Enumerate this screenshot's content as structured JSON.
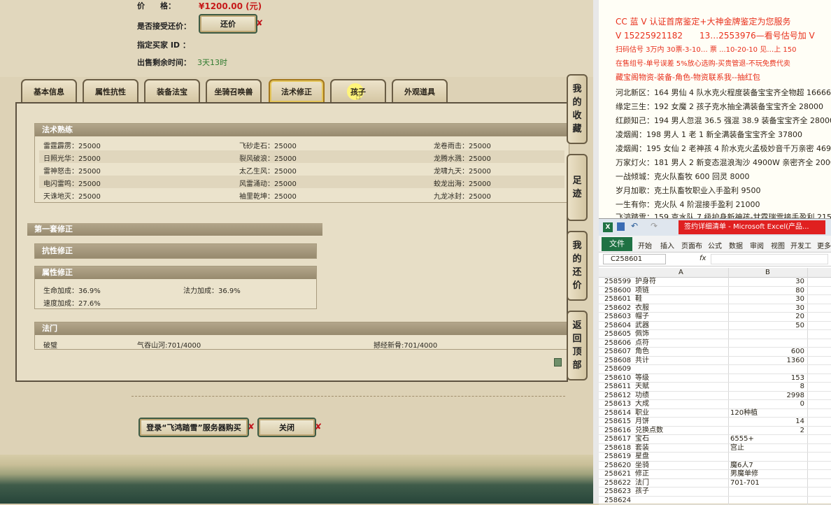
{
  "game": {
    "price_label": "价　　格：",
    "price_value": "¥1200.00 (元)",
    "accept_label": "是否接受还价：",
    "counter_btn": "还价",
    "buyer_label": "指定买家 ID ：",
    "time_label": "出售剩余时间：",
    "time_value": "3天13时",
    "tabs": [
      "基本信息",
      "属性抗性",
      "装备法宝",
      "坐骑召唤兽",
      "法术修正",
      "孩子",
      "外观道具"
    ],
    "skill_header": "法术熟练",
    "skills": [
      [
        "雷霆霹雳：25000",
        "飞砂走石：25000",
        "龙卷雨击：25000"
      ],
      [
        "日照光华：25000",
        "裂风破浪：25000",
        "龙腾水溅：25000"
      ],
      [
        "雷神怒击：25000",
        "太乙生风：25000",
        "龙啸九天：25000"
      ],
      [
        "电闪雷鸣：25000",
        "风雷涌动：25000",
        "蛟龙出海：25000"
      ],
      [
        "天诛地灭：25000",
        "袖里乾坤：25000",
        "九龙冰封：25000"
      ]
    ],
    "mod_set_header": "第一套修正",
    "resist_header": "抗性修正",
    "attr_header": "属性修正",
    "attr_hp": "生命加成：36.9%",
    "attr_mp": "法力加成：36.9%",
    "attr_speed": "速度加成：27.6%",
    "fa_header": "法门",
    "fa_items": [
      "破璧",
      "气吞山河:701/4000",
      "撼经新骨:701/4000"
    ],
    "login_btn": "登录“飞鸿踏雪”服务器购买",
    "close_btn": "关闭",
    "side_buttons": [
      [
        "我",
        "的",
        "收",
        "藏"
      ],
      [
        "足",
        "迹"
      ],
      [
        "我",
        "的",
        "还",
        "价"
      ],
      [
        "返",
        "回",
        "顶",
        "部"
      ]
    ]
  },
  "notes": {
    "lines": [
      "CC 蓝 V 认证首席鉴定+大神金牌鉴定为您服务",
      "V 15225921182　　13…2553976—看号估号加 V",
      "扫码估号 3万内 30票-3-10… 票 ...10-20-10 见…上 150",
      "在售组号-单号误差 5%放心选购-买贵管退-不玩免费代卖",
      "藏宝阁物资-装备-角色-物资联系我--抽红包",
      "河北新区：164 男仙 4 队水克火程度装备宝宝齐全物超 16666",
      "缘定三生：192 女魔 2 孩子克水抽全满装备宝宝齐全 28000",
      "红颜知己：194 男人忽混 36.5 强混 38.9 装备宝宝齐全 28000",
      "凌烟阁：198 男人 1 老 1 新全满装备宝宝齐全 37800",
      "凌烟阁：195 女仙 2 老神孩 4 阶水克火孟极妙音千万亲密 469",
      "万家灯火：181 男人 2 新变态混浪淘沙 4900W 亲密齐全 20000",
      "一战倾城：克火队畜牧 600 回灵 8000",
      "岁月加歌：克土队畜牧职业入手盈利 9500",
      "一生有你：克火队 4 阶混接手盈利 21000",
      "飞鸿踏雪：159 克水队 7 级护身新神孩-甘霖瑞雪接手盈利 215"
    ],
    "colors": [
      "#e8301c",
      "#e8301c",
      "#e8301c",
      "#e8301c",
      "#e8301c",
      "#111111",
      "#111111",
      "#111111",
      "#111111",
      "#111111",
      "#111111",
      "#111111",
      "#111111",
      "#111111",
      "#111111"
    ]
  },
  "excel": {
    "title": "签约详细清单 - Microsoft Excel(产品...",
    "ribbon_tabs": [
      "文件",
      "开始",
      "插入",
      "页面布",
      "公式",
      "数据",
      "审阅",
      "视图",
      "开发工",
      "更多"
    ],
    "name_box": "C258601",
    "fx": "fx",
    "col_a": "A",
    "col_b": "B",
    "rows": [
      [
        "258599",
        "护身符",
        "30"
      ],
      [
        "258600",
        "项链",
        "80"
      ],
      [
        "258601",
        "鞋",
        "30"
      ],
      [
        "258602",
        "衣服",
        "30"
      ],
      [
        "258603",
        "帽子",
        "20"
      ],
      [
        "258604",
        "武器",
        "50"
      ],
      [
        "258605",
        "佩饰",
        ""
      ],
      [
        "258606",
        "点符",
        ""
      ],
      [
        "258607",
        "角色",
        "600"
      ],
      [
        "258608",
        "共计",
        "1360"
      ],
      [
        "258609",
        "",
        ""
      ],
      [
        "258610",
        "等级",
        "153"
      ],
      [
        "258611",
        "天赋",
        "8"
      ],
      [
        "258612",
        "功绩",
        "2998"
      ],
      [
        "258613",
        "大成",
        "0"
      ],
      [
        "258614",
        "职业",
        "120种植"
      ],
      [
        "258615",
        "月饼",
        "14"
      ],
      [
        "258616",
        "兑换点数",
        "2"
      ],
      [
        "258617",
        "宝石",
        "6555+"
      ],
      [
        "258618",
        "套装",
        "宫止"
      ],
      [
        "258619",
        "星盘",
        ""
      ],
      [
        "258620",
        "坐骑",
        "魔6人7"
      ],
      [
        "258621",
        "修正",
        "男魔单修"
      ],
      [
        "258622",
        "法门",
        "701-701"
      ],
      [
        "258623",
        "孩子",
        ""
      ],
      [
        "258624",
        "",
        ""
      ]
    ]
  }
}
